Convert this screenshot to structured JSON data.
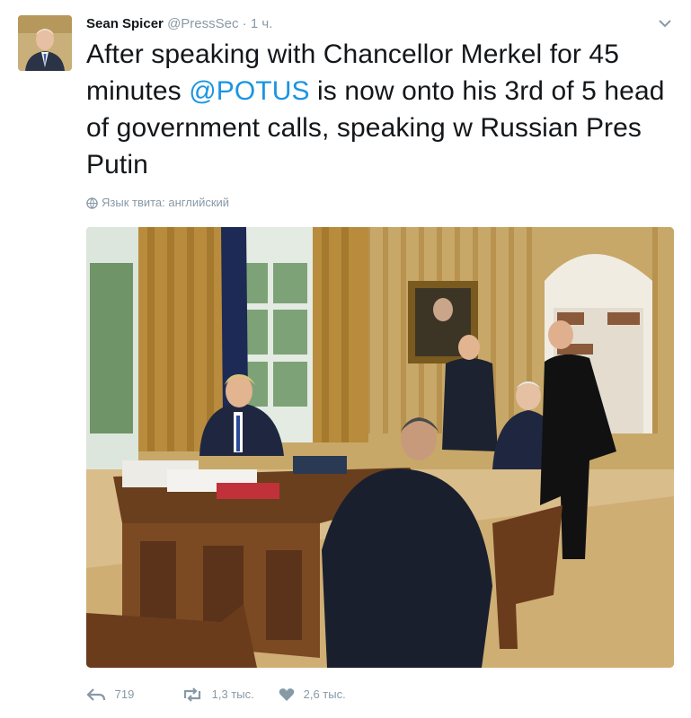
{
  "tweet": {
    "author_name": "Sean Spicer",
    "author_handle": "@PressSec",
    "separator": "·",
    "timestamp": "1 ч.",
    "text_part1": "After speaking with Chancellor Merkel for 45 minutes ",
    "mention": "@POTUS",
    "text_part2": " is now onto his 3rd of 5 head of government calls, speaking w Russian Pres Putin",
    "language_label": "Язык твита: английский"
  },
  "actions": {
    "reply_count": "719",
    "retweet_count": "1,3 тыс.",
    "like_count": "2,6 тыс."
  },
  "colors": {
    "link": "#1b95e0",
    "muted": "#8899a6",
    "text": "#14171a"
  },
  "icons": [
    "chevron-down-icon",
    "globe-icon",
    "reply-icon",
    "retweet-icon",
    "heart-icon"
  ]
}
